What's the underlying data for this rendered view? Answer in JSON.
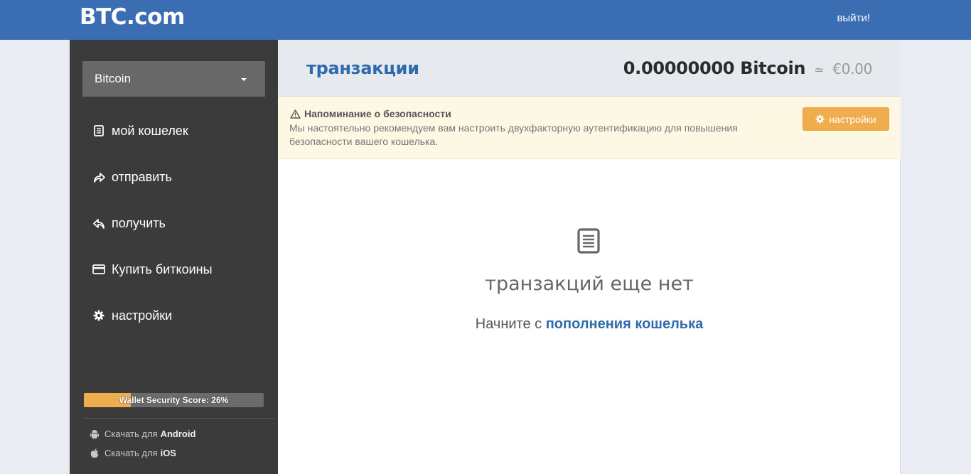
{
  "header": {
    "logo": "BTC.com",
    "logout": "выйти!"
  },
  "sidebar": {
    "coin_selected": "Bitcoin",
    "items": [
      {
        "label": "мой кошелек",
        "icon": "wallet-list-icon"
      },
      {
        "label": "отправить",
        "icon": "send-arrow-icon"
      },
      {
        "label": "получить",
        "icon": "receive-arrow-icon"
      },
      {
        "label": "Купить биткоины",
        "icon": "credit-card-icon"
      },
      {
        "label": "настройки",
        "icon": "gear-icon"
      }
    ],
    "security_score": {
      "label": "Wallet Security Score: 26%",
      "percent": 26
    },
    "downloads": [
      {
        "prefix": "Скачать для",
        "platform": "Android",
        "icon": "android-icon"
      },
      {
        "prefix": "Скачать для",
        "platform": "iOS",
        "icon": "apple-icon"
      }
    ]
  },
  "main": {
    "title": "транзакции",
    "balance": {
      "btc": "0.00000000 Bitcoin",
      "approx": "≃",
      "fiat": "€0.00"
    },
    "alert": {
      "title": "Напоминание о безопасности",
      "body": "Мы настоятельно рекомендуем вам настроить двухфакторную аутентификацию для повышения безопасности вашего кошелька.",
      "button": "настройки"
    },
    "empty": {
      "title": "транзакций еще нет",
      "prefix": "Начните с",
      "link": "пополнения кошелька"
    }
  },
  "colors": {
    "header": "#3a6db2",
    "sidebar": "#3b3b3b",
    "accent": "#2f6aad",
    "warning": "#f0ad4e"
  }
}
